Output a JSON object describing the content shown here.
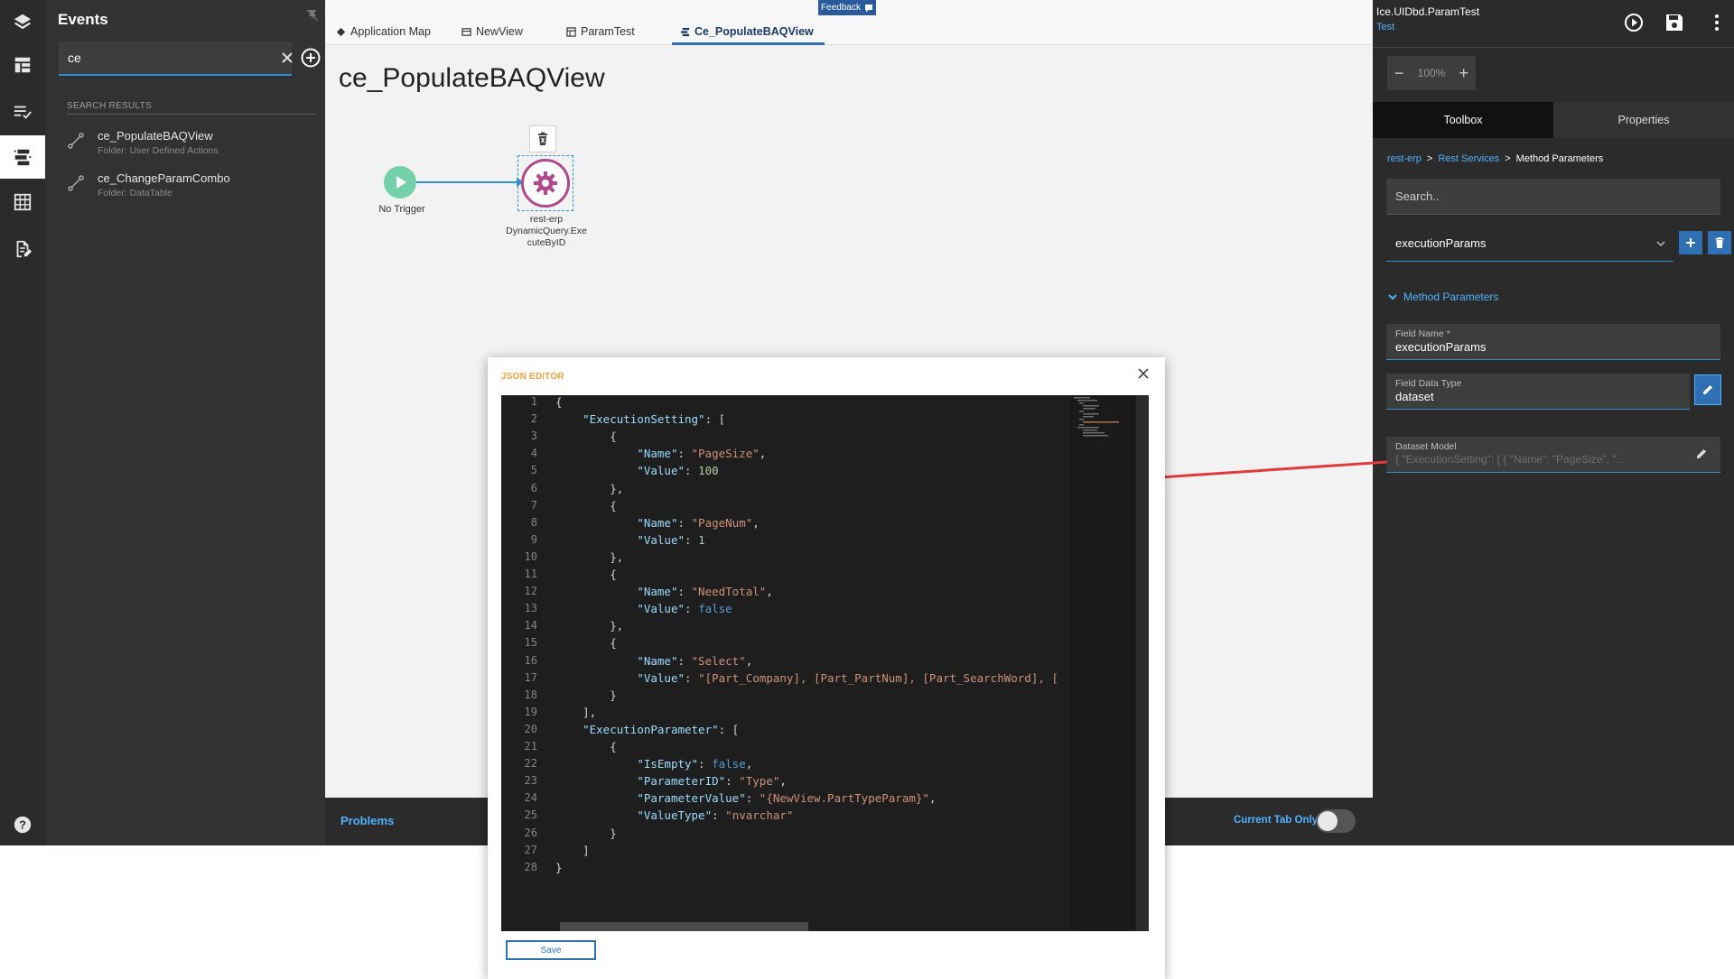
{
  "rail": {
    "items": [
      {
        "icon": "layers-icon"
      },
      {
        "icon": "layout-icon"
      },
      {
        "icon": "list-check-icon"
      },
      {
        "icon": "events-icon",
        "active": true
      },
      {
        "icon": "data-table-icon"
      },
      {
        "icon": "document-edit-icon"
      }
    ],
    "help_icon": "help-icon"
  },
  "events_panel": {
    "title": "Events",
    "search_value": "ce",
    "search_results_header": "SEARCH RESULTS",
    "results": [
      {
        "name": "ce_PopulateBAQView",
        "folder": "Folder: User Defined Actions"
      },
      {
        "name": "ce_ChangeParamCombo",
        "folder": "Folder: DataTable"
      }
    ]
  },
  "tabs": [
    {
      "label": "Application Map",
      "icon": "diamond-icon"
    },
    {
      "label": "NewView",
      "icon": "view-icon"
    },
    {
      "label": "ParamTest",
      "icon": "grid-icon"
    },
    {
      "label": "Ce_PopulateBAQView",
      "icon": "events-icon",
      "active": true
    }
  ],
  "feedback_label": "Feedback",
  "page_title": "ce_PopulateBAQView",
  "flow": {
    "trigger_label": "No Trigger",
    "action_label_line1": "rest-erp",
    "action_label_line2": "DynamicQuery.Exe",
    "action_label_line3": "cuteByID"
  },
  "bottom_bar": {
    "problems": "Problems",
    "current_tab_only": "Current Tab Only",
    "toggle_on": false
  },
  "right_panel": {
    "title": "Ice.UIDbd.ParamTest",
    "subtitle": "Test",
    "zoom": "100%",
    "tabs": [
      "Toolbox",
      "Properties"
    ],
    "breadcrumb": [
      "rest-erp",
      "Rest Services",
      "Method Parameters"
    ],
    "search_placeholder": "Search..",
    "selected_param": "executionParams",
    "section_title": "Method Parameters",
    "fields": [
      {
        "label": "Field Name *",
        "value": "executionParams"
      },
      {
        "label": "Field Data Type",
        "value": "dataset"
      },
      {
        "label": "Dataset Model",
        "value": "{ \"ExecutionSetting\": [  {     \"Name\": \"PageSize\",    \"..."
      }
    ]
  },
  "modal": {
    "title": "JSON EDITOR",
    "save_label": "Save",
    "lines": [
      "{",
      "    \"ExecutionSetting\": [",
      "        {",
      "            \"Name\": \"PageSize\",",
      "            \"Value\": 100",
      "        },",
      "        {",
      "            \"Name\": \"PageNum\",",
      "            \"Value\": 1",
      "        },",
      "        {",
      "            \"Name\": \"NeedTotal\",",
      "            \"Value\": false",
      "        },",
      "        {",
      "            \"Name\": \"Select\",",
      "            \"Value\": \"[Part_Company], [Part_PartNum], [Part_SearchWord], [",
      "        }",
      "    ],",
      "    \"ExecutionParameter\": [",
      "        {",
      "            \"IsEmpty\": false,",
      "            \"ParameterID\": \"Type\",",
      "            \"ParameterValue\": \"{NewView.PartTypeParam}\",",
      "            \"ValueType\": \"nvarchar\"",
      "        }",
      "    ]",
      "}"
    ]
  },
  "colors": {
    "accent": "#2f6fb3",
    "link": "#4fb3ff",
    "trigger": "#74d0a8",
    "action_ring": "#b04a8e",
    "annotation_arrow": "#e03a3a"
  }
}
